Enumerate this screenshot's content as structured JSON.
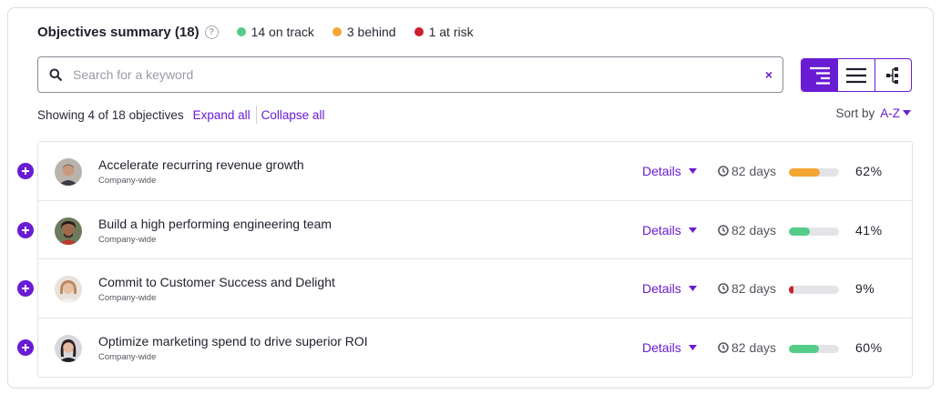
{
  "summary": {
    "title": "Objectives summary (18)",
    "help_glyph": "?",
    "statuses": [
      {
        "label": "14 on track",
        "color": "#55cc88"
      },
      {
        "label": "3 behind",
        "color": "#f5a534"
      },
      {
        "label": "1 at risk",
        "color": "#cc1f2a"
      }
    ]
  },
  "search": {
    "placeholder": "Search for a keyword",
    "value": "",
    "clear_glyph": "×"
  },
  "view_toggle": {
    "options": [
      "tree-view-icon",
      "list-view-icon",
      "hierarchy-view-icon"
    ],
    "active_index": 0
  },
  "showing": {
    "text": "Showing 4 of 18 objectives",
    "expand_all": "Expand all",
    "collapse_all": "Collapse all"
  },
  "sort": {
    "label": "Sort by",
    "value": "A-Z"
  },
  "colors": {
    "accent": "#6a1bd4",
    "on_track": "#55cc88",
    "behind": "#f5a534",
    "at_risk": "#cc1f2a"
  },
  "objectives": [
    {
      "title": "Accelerate recurring revenue growth",
      "subtitle": "Company-wide",
      "details_label": "Details",
      "days": "82 days",
      "progress": 62,
      "progress_label": "62%",
      "status_color": "#f5a534",
      "avatar": "avatar-1"
    },
    {
      "title": "Build a high performing engineering team",
      "subtitle": "Company-wide",
      "details_label": "Details",
      "days": "82 days",
      "progress": 41,
      "progress_label": "41%",
      "status_color": "#55cc88",
      "avatar": "avatar-2"
    },
    {
      "title": "Commit to Customer Success and Delight",
      "subtitle": "Company-wide",
      "details_label": "Details",
      "days": "82 days",
      "progress": 9,
      "progress_label": "9%",
      "status_color": "#cc1f2a",
      "avatar": "avatar-3"
    },
    {
      "title": "Optimize marketing spend to drive superior ROI",
      "subtitle": "Company-wide",
      "details_label": "Details",
      "days": "82 days",
      "progress": 60,
      "progress_label": "60%",
      "status_color": "#55cc88",
      "avatar": "avatar-4"
    }
  ]
}
